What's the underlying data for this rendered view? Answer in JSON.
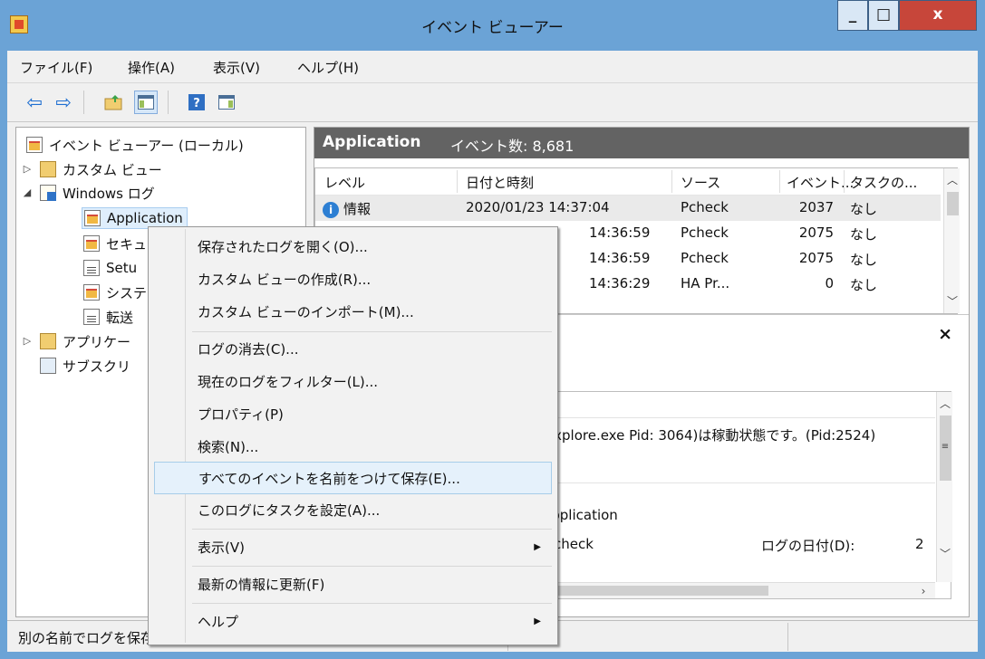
{
  "window": {
    "title": "イベント ビューアー",
    "minimize": "_",
    "maximize": "□",
    "close": "x"
  },
  "menubar": [
    "ファイル(F)",
    "操作(A)",
    "表示(V)",
    "ヘルプ(H)"
  ],
  "toolbar": {
    "back_icon": "arrow-left",
    "forward_icon": "arrow-right",
    "help_icon": "help"
  },
  "tree": {
    "root": "イベント ビューアー (ローカル)",
    "custom_views": "カスタム ビュー",
    "windows_logs": "Windows ログ",
    "application": "Application",
    "security": "セキュ",
    "setup": "Setu",
    "system": "システ",
    "forwarded": "転送",
    "apps_services": "アプリケー",
    "subscriptions": "サブスクリ"
  },
  "right": {
    "title": "Application",
    "count": "イベント数: 8,681",
    "columns": [
      "レベル",
      "日付と時刻",
      "ソース",
      "イベント...",
      "タスクの..."
    ],
    "rows": [
      {
        "level": "情報",
        "datetime": "2020/01/23 14:37:04",
        "source": "Pcheck",
        "event": "2037",
        "task": "なし"
      },
      {
        "datetime": "14:36:59",
        "source": "Pcheck",
        "event": "2075",
        "task": "なし"
      },
      {
        "datetime": "14:36:59",
        "source": "Pcheck",
        "event": "2075",
        "task": "なし"
      },
      {
        "datetime": "14:36:29",
        "source": "HA Pr...",
        "event": "0",
        "task": "なし"
      }
    ],
    "close": "×",
    "detail_message": "iexplore.exe Pid: 3064)は稼動状態です。(Pid:2524)",
    "detail_log_name": "Application",
    "detail_source": "Pcheck",
    "detail_date_label": "ログの日付(D):",
    "detail_date_value": "2"
  },
  "context_menu": {
    "items": [
      {
        "label": "保存されたログを開く(O)..."
      },
      {
        "label": "カスタム ビューの作成(R)..."
      },
      {
        "label": "カスタム ビューのインポート(M)..."
      },
      {
        "label": "ログの消去(C)..."
      },
      {
        "label": "現在のログをフィルター(L)..."
      },
      {
        "label": "プロパティ(P)"
      },
      {
        "label": "検索(N)..."
      },
      {
        "label": "すべてのイベントを名前をつけて保存(E)..."
      },
      {
        "label": "このログにタスクを設定(A)..."
      },
      {
        "label": "表示(V)"
      },
      {
        "label": "最新の情報に更新(F)"
      },
      {
        "label": "ヘルプ"
      }
    ]
  },
  "statusbar": {
    "text": "別の名前でログを保存します"
  }
}
